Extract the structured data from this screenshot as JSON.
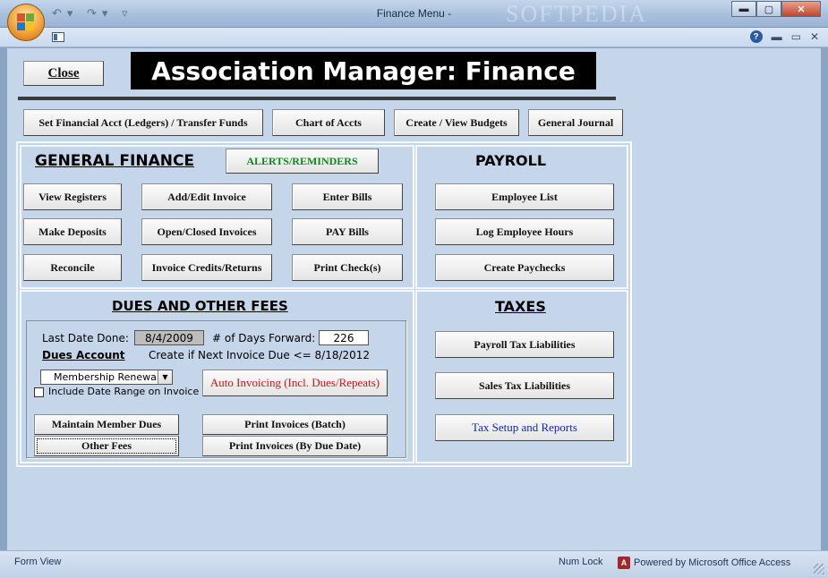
{
  "window": {
    "title": "Finance Menu -",
    "watermark": "SOFTPEDIA",
    "minimize": "▬",
    "maximize": "▢",
    "close": "✕",
    "help": "?",
    "restore": "▭",
    "sub_minimize": "▬",
    "sub_close": "✕"
  },
  "header": {
    "close_button": "Close",
    "title": "Association Manager: Finance"
  },
  "top_buttons": {
    "ledgers": "Set Financial Acct (Ledgers) / Transfer Funds",
    "chart": "Chart of Accts",
    "budgets": "Create / View Budgets",
    "journal": "General Journal"
  },
  "general_finance": {
    "heading": "GENERAL FINANCE",
    "alerts": "ALERTS/REMINDERS",
    "view_registers": "View Registers",
    "add_invoice": "Add/Edit  Invoice",
    "enter_bills": "Enter Bills",
    "make_deposits": "Make Deposits",
    "open_closed": "Open/Closed Invoices",
    "pay_bills": "PAY Bills",
    "reconcile": "Reconcile",
    "invoice_credits": "Invoice Credits/Returns",
    "print_checks": "Print Check(s)"
  },
  "payroll": {
    "heading": "PAYROLL",
    "employee_list": "Employee List",
    "log_hours": "Log Employee Hours",
    "create_paychecks": "Create Paychecks"
  },
  "dues": {
    "heading": "DUES AND OTHER FEES",
    "last_date_label": "Last Date Done:",
    "last_date_value": "8/4/2009",
    "days_forward_label": "# of Days Forward:",
    "days_forward_value": "226",
    "dues_account": "Dues Account",
    "next_due_text": "Create if Next Invoice Due <= 8/18/2012",
    "combo_value": "Membership Renewal",
    "include_range": "Include Date Range on Invoice",
    "auto_invoicing": "Auto Invoicing (Incl. Dues/Repeats)",
    "maintain_dues": "Maintain Member Dues",
    "other_fees": "Other Fees",
    "print_batch": "Print Invoices (Batch)",
    "print_due_date": "Print Invoices (By Due Date)"
  },
  "taxes": {
    "heading": "TAXES",
    "payroll_tax": "Payroll Tax Liabilities",
    "sales_tax": "Sales Tax Liabilities",
    "tax_setup": "Tax  Setup and Reports"
  },
  "status": {
    "view": "Form View",
    "numlock": "Num Lock",
    "powered": "Powered by Microsoft Office Access"
  }
}
